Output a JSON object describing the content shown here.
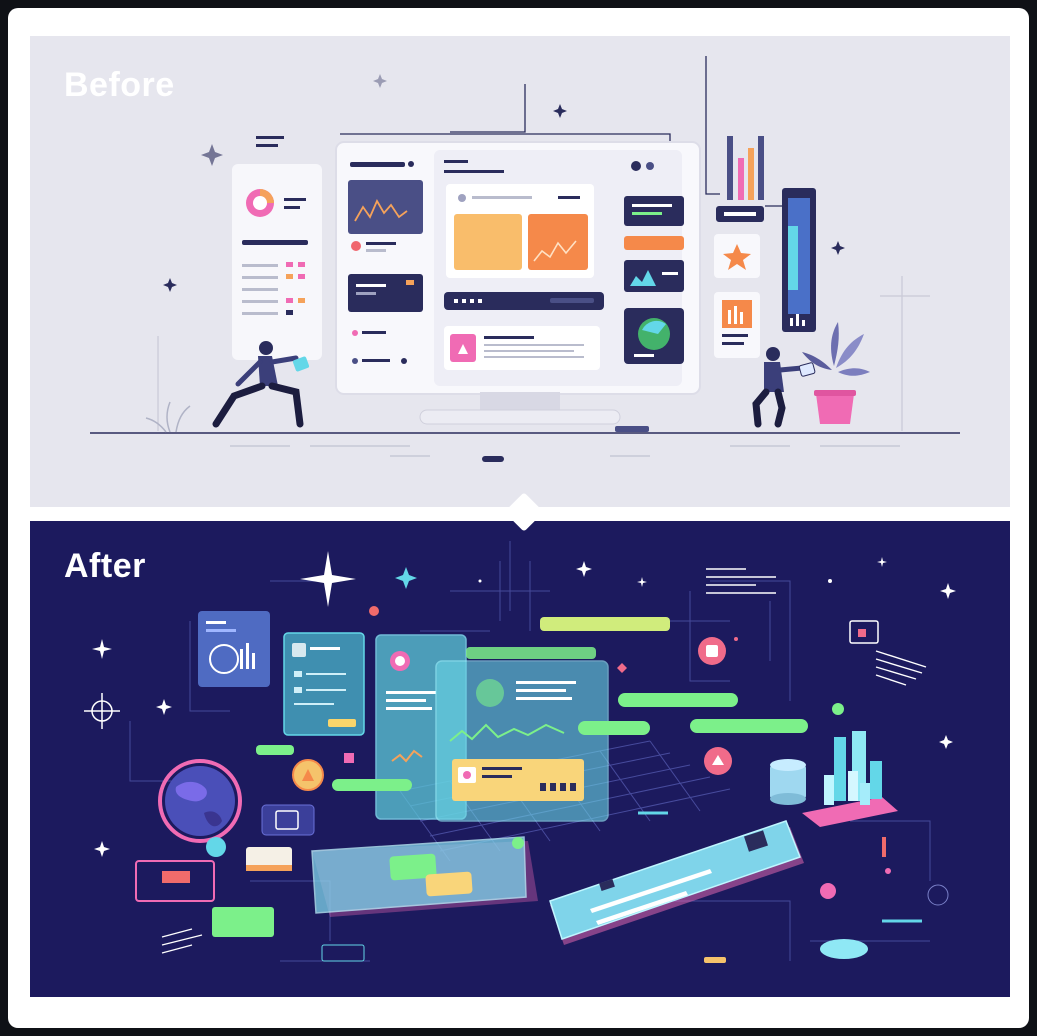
{
  "labels": {
    "before": "Before",
    "after": "After"
  },
  "colors": {
    "before_background": "#e6e6ee",
    "after_background": "#1c1a5e",
    "accent_orange": "#f5a25a",
    "accent_pink": "#f06bb4",
    "accent_green": "#7cf08a",
    "accent_cyan": "#63d7e8",
    "navy": "#2a2c5c"
  },
  "icons": {
    "star_badge": "star-icon",
    "pie_chart": "pie-chart-icon",
    "globe": "globe-icon",
    "plant": "plant-icon"
  }
}
